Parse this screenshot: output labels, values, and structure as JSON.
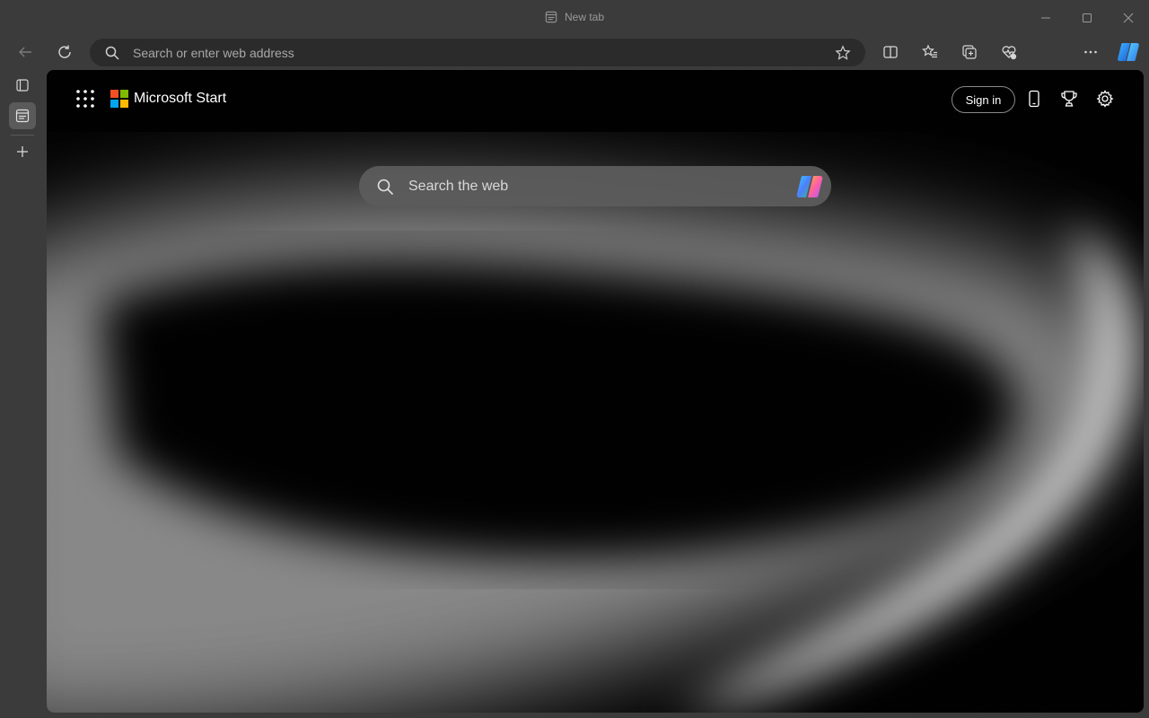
{
  "window": {
    "tab_title": "New tab"
  },
  "toolbar": {
    "address_placeholder": "Search or enter web address"
  },
  "newtab": {
    "brand": "Microsoft Start",
    "signin_label": "Sign in",
    "search_placeholder": "Search the web"
  },
  "colors": {
    "chrome_bg": "#3b3b3b",
    "address_bg": "#2b2b2b",
    "search_bg": "#5c5c5c",
    "ms_red": "#f25022",
    "ms_green": "#7fba00",
    "ms_blue": "#00a4ef",
    "ms_yellow": "#ffb900"
  },
  "icons": [
    "back-arrow-icon",
    "refresh-icon",
    "search-icon",
    "favorite-star-icon",
    "split-screen-icon",
    "favorites-icon",
    "collections-icon",
    "browser-essentials-icon",
    "profile-avatar-icon",
    "more-menu-icon",
    "copilot-icon",
    "tab-actions-icon",
    "vertical-tab-icon",
    "new-tab-plus-icon",
    "app-launcher-icon",
    "microsoft-logo",
    "phone-icon",
    "rewards-trophy-icon",
    "settings-gear-icon",
    "minimize-icon",
    "maximize-icon",
    "close-icon"
  ]
}
